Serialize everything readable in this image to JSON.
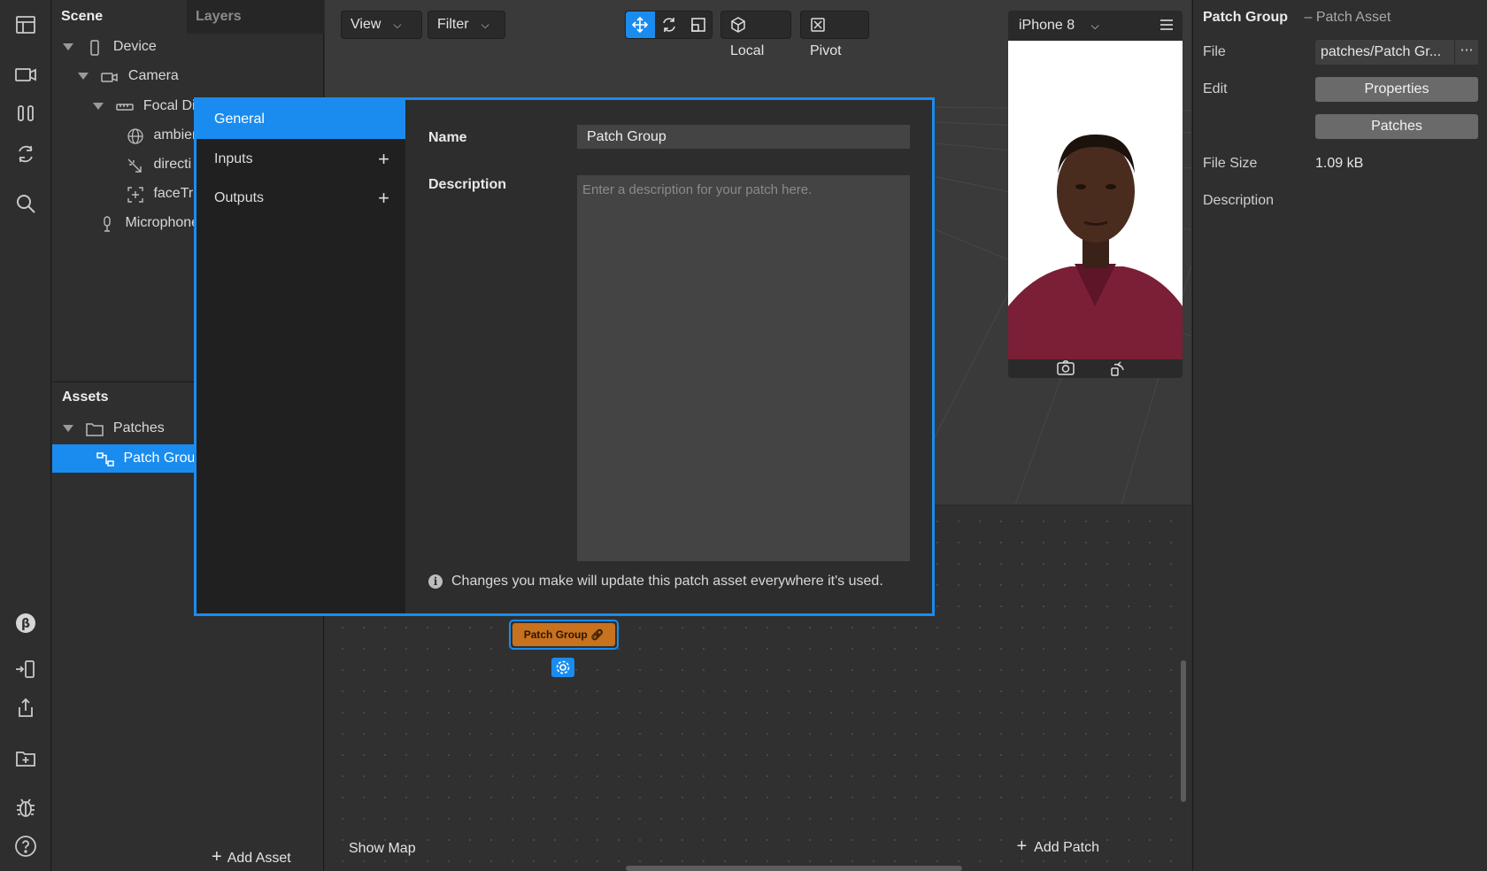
{
  "scene_panel": {
    "tabs": [
      "Scene",
      "Layers"
    ],
    "tree": [
      {
        "label": "Device",
        "icon": "device-icon",
        "expanded": true
      },
      {
        "label": "Camera",
        "icon": "camera-icon",
        "expanded": true
      },
      {
        "label": "Focal Dis",
        "icon": "focal-distance-icon",
        "expanded": true
      },
      {
        "label": "ambien",
        "icon": "globe-icon"
      },
      {
        "label": "directi",
        "icon": "directional-light-icon"
      },
      {
        "label": "faceTra",
        "icon": "face-tracker-icon"
      },
      {
        "label": "Microphone",
        "icon": "microphone-icon"
      }
    ]
  },
  "assets_panel": {
    "title": "Assets",
    "folder": "Patches",
    "selected_item": "Patch Grou",
    "add_label": "Add Asset"
  },
  "toolbar": {
    "view": "View",
    "filter": "Filter",
    "local": "Local",
    "pivot": "Pivot"
  },
  "simulator": {
    "device": "iPhone 8"
  },
  "dialog": {
    "nav": {
      "general": "General",
      "inputs": "Inputs",
      "outputs": "Outputs"
    },
    "name_label": "Name",
    "name_value": "Patch Group",
    "description_label": "Description",
    "description_placeholder": "Enter a description for your patch here.",
    "info_text": "Changes you make will update this patch asset everywhere it's used."
  },
  "patch_editor": {
    "node_label": "Patch Group",
    "show_map": "Show Map",
    "add_patch": "Add Patch"
  },
  "properties": {
    "title": "Patch Group",
    "subtitle": "– Patch Asset",
    "file_label": "File",
    "file_value": "patches/Patch Gr...",
    "edit_label": "Edit",
    "properties_button": "Properties",
    "patches_button": "Patches",
    "file_size_label": "File Size",
    "file_size_value": "1.09 kB",
    "description_label": "Description"
  },
  "colors": {
    "accent": "#1a8cf0",
    "node": "#c8711f"
  }
}
